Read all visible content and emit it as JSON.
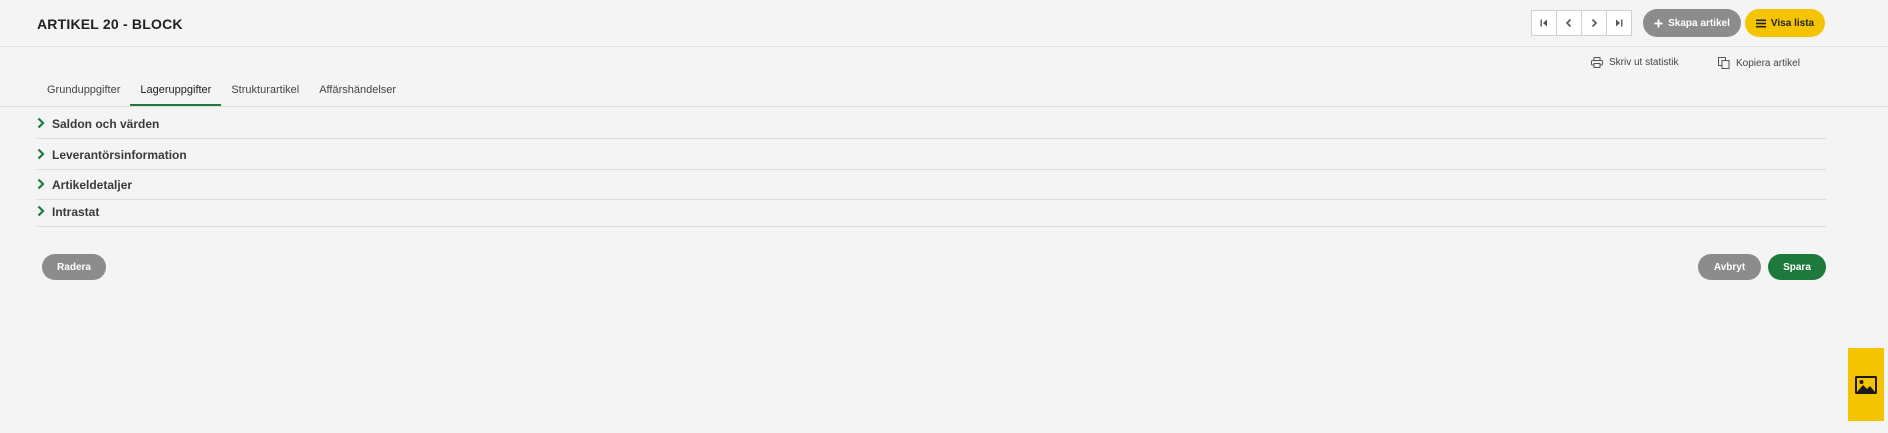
{
  "header": {
    "title": "ARTIKEL 20 - BLOCK",
    "create_label": "Skapa artikel",
    "list_label": "Visa lista"
  },
  "actions": {
    "print_label": "Skriv ut statistik",
    "copy_label": "Kopiera artikel"
  },
  "tabs": [
    {
      "label": "Grunduppgifter",
      "active": false
    },
    {
      "label": "Lageruppgifter",
      "active": true
    },
    {
      "label": "Strukturartikel",
      "active": false
    },
    {
      "label": "Affärshändelser",
      "active": false
    }
  ],
  "sections": [
    {
      "label": "Saldon och värden"
    },
    {
      "label": "Leverantörsinformation"
    },
    {
      "label": "Artikeldetaljer"
    },
    {
      "label": "Intrastat"
    }
  ],
  "footer": {
    "delete_label": "Radera",
    "cancel_label": "Avbryt",
    "save_label": "Spara"
  },
  "colors": {
    "accent_green": "#1e7a3c",
    "accent_yellow": "#f5c400",
    "neutral_button": "#8c8c8c"
  },
  "icons": [
    "first-page-icon",
    "prev-icon",
    "next-icon",
    "last-page-icon",
    "plus-icon",
    "list-icon",
    "printer-icon",
    "copy-icon",
    "chevron-right-icon",
    "image-icon"
  ]
}
